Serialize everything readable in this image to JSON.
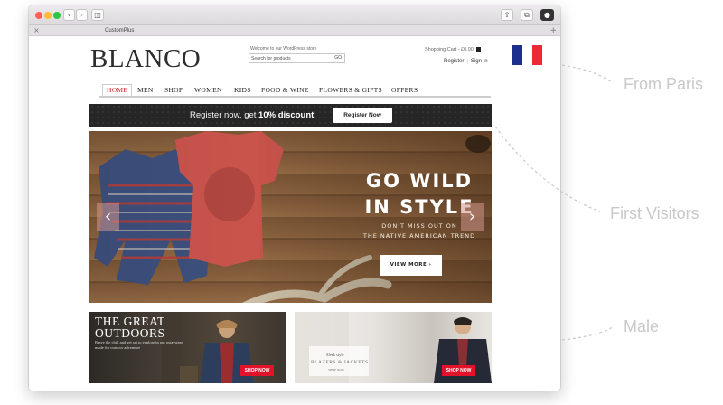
{
  "window": {
    "tab_title": "CustomPlus",
    "icons": [
      "close-icon",
      "back-icon",
      "forward-icon",
      "sidebar-icon",
      "share-icon",
      "tabs-icon",
      "extension-icon",
      "add-tab-icon"
    ]
  },
  "header": {
    "logo": "BLANCO",
    "welcome": "Welcome to our WordPress store",
    "search_placeholder": "Search for products",
    "search_button": "GO",
    "cart": "Shopping Cart - £0.00",
    "register": "Register",
    "sign_in": "Sign In",
    "flag_colors": [
      "#1c2f8f",
      "#ffffff",
      "#ed2939"
    ]
  },
  "nav": {
    "items": [
      "HOME",
      "MEN",
      "SHOP",
      "WOMEN",
      "KIDS",
      "FOOD & WINE",
      "FLOWERS & GIFTS",
      "OFFERS"
    ],
    "active": "HOME",
    "active_color": "#d32020"
  },
  "promo": {
    "text_before": "Register now, get ",
    "text_bold": "10% discount",
    "text_after": ".",
    "button": "Register Now"
  },
  "hero": {
    "heading": "GO WILD\nIN STYLE",
    "subheading": "DON'T MISS OUT ON\nTHE NATIVE AMERICAN TREND",
    "button": "VIEW MORE ›",
    "prev_arrow": "‹",
    "next_arrow": "›"
  },
  "banners": {
    "outdoors": {
      "title": "THE GREAT\nOUTDOORS",
      "text": "Brave the chill and get set to explore in our outerwear made for outdoor adventure",
      "button": "SHOP NOW"
    },
    "blazers": {
      "pre": "Sleek style",
      "title": "BLAZERS & JACKETS",
      "sub": "SHOP NOW",
      "button": "SHOP NOW"
    }
  },
  "annotations": {
    "from_paris": "From Paris",
    "first_visitors": "First Visitors",
    "male": "Male"
  },
  "colors": {
    "promo_bg": "#262626",
    "shop_button": "#e2122b",
    "annotation_text": "#c9c9c9"
  }
}
